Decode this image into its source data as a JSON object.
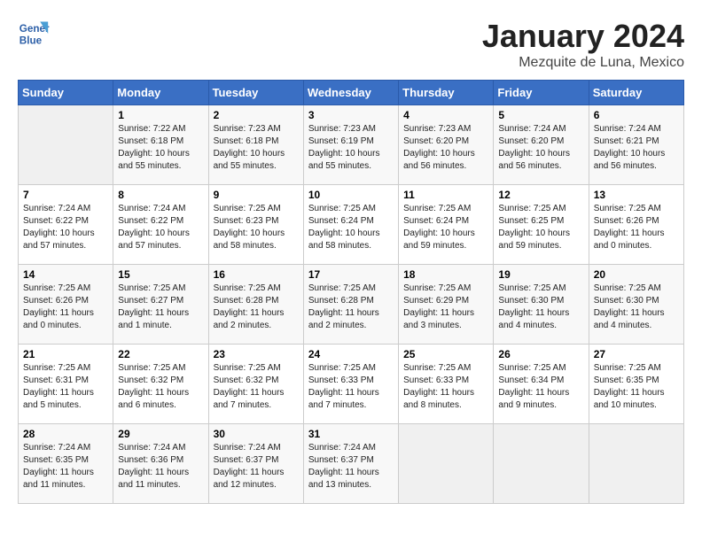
{
  "logo": {
    "line1": "General",
    "line2": "Blue"
  },
  "title": "January 2024",
  "subtitle": "Mezquite de Luna, Mexico",
  "headers": [
    "Sunday",
    "Monday",
    "Tuesday",
    "Wednesday",
    "Thursday",
    "Friday",
    "Saturday"
  ],
  "weeks": [
    [
      {
        "day": "",
        "info": ""
      },
      {
        "day": "1",
        "info": "Sunrise: 7:22 AM\nSunset: 6:18 PM\nDaylight: 10 hours\nand 55 minutes."
      },
      {
        "day": "2",
        "info": "Sunrise: 7:23 AM\nSunset: 6:18 PM\nDaylight: 10 hours\nand 55 minutes."
      },
      {
        "day": "3",
        "info": "Sunrise: 7:23 AM\nSunset: 6:19 PM\nDaylight: 10 hours\nand 55 minutes."
      },
      {
        "day": "4",
        "info": "Sunrise: 7:23 AM\nSunset: 6:20 PM\nDaylight: 10 hours\nand 56 minutes."
      },
      {
        "day": "5",
        "info": "Sunrise: 7:24 AM\nSunset: 6:20 PM\nDaylight: 10 hours\nand 56 minutes."
      },
      {
        "day": "6",
        "info": "Sunrise: 7:24 AM\nSunset: 6:21 PM\nDaylight: 10 hours\nand 56 minutes."
      }
    ],
    [
      {
        "day": "7",
        "info": "Sunrise: 7:24 AM\nSunset: 6:22 PM\nDaylight: 10 hours\nand 57 minutes."
      },
      {
        "day": "8",
        "info": "Sunrise: 7:24 AM\nSunset: 6:22 PM\nDaylight: 10 hours\nand 57 minutes."
      },
      {
        "day": "9",
        "info": "Sunrise: 7:25 AM\nSunset: 6:23 PM\nDaylight: 10 hours\nand 58 minutes."
      },
      {
        "day": "10",
        "info": "Sunrise: 7:25 AM\nSunset: 6:24 PM\nDaylight: 10 hours\nand 58 minutes."
      },
      {
        "day": "11",
        "info": "Sunrise: 7:25 AM\nSunset: 6:24 PM\nDaylight: 10 hours\nand 59 minutes."
      },
      {
        "day": "12",
        "info": "Sunrise: 7:25 AM\nSunset: 6:25 PM\nDaylight: 10 hours\nand 59 minutes."
      },
      {
        "day": "13",
        "info": "Sunrise: 7:25 AM\nSunset: 6:26 PM\nDaylight: 11 hours\nand 0 minutes."
      }
    ],
    [
      {
        "day": "14",
        "info": "Sunrise: 7:25 AM\nSunset: 6:26 PM\nDaylight: 11 hours\nand 0 minutes."
      },
      {
        "day": "15",
        "info": "Sunrise: 7:25 AM\nSunset: 6:27 PM\nDaylight: 11 hours\nand 1 minute."
      },
      {
        "day": "16",
        "info": "Sunrise: 7:25 AM\nSunset: 6:28 PM\nDaylight: 11 hours\nand 2 minutes."
      },
      {
        "day": "17",
        "info": "Sunrise: 7:25 AM\nSunset: 6:28 PM\nDaylight: 11 hours\nand 2 minutes."
      },
      {
        "day": "18",
        "info": "Sunrise: 7:25 AM\nSunset: 6:29 PM\nDaylight: 11 hours\nand 3 minutes."
      },
      {
        "day": "19",
        "info": "Sunrise: 7:25 AM\nSunset: 6:30 PM\nDaylight: 11 hours\nand 4 minutes."
      },
      {
        "day": "20",
        "info": "Sunrise: 7:25 AM\nSunset: 6:30 PM\nDaylight: 11 hours\nand 4 minutes."
      }
    ],
    [
      {
        "day": "21",
        "info": "Sunrise: 7:25 AM\nSunset: 6:31 PM\nDaylight: 11 hours\nand 5 minutes."
      },
      {
        "day": "22",
        "info": "Sunrise: 7:25 AM\nSunset: 6:32 PM\nDaylight: 11 hours\nand 6 minutes."
      },
      {
        "day": "23",
        "info": "Sunrise: 7:25 AM\nSunset: 6:32 PM\nDaylight: 11 hours\nand 7 minutes."
      },
      {
        "day": "24",
        "info": "Sunrise: 7:25 AM\nSunset: 6:33 PM\nDaylight: 11 hours\nand 7 minutes."
      },
      {
        "day": "25",
        "info": "Sunrise: 7:25 AM\nSunset: 6:33 PM\nDaylight: 11 hours\nand 8 minutes."
      },
      {
        "day": "26",
        "info": "Sunrise: 7:25 AM\nSunset: 6:34 PM\nDaylight: 11 hours\nand 9 minutes."
      },
      {
        "day": "27",
        "info": "Sunrise: 7:25 AM\nSunset: 6:35 PM\nDaylight: 11 hours\nand 10 minutes."
      }
    ],
    [
      {
        "day": "28",
        "info": "Sunrise: 7:24 AM\nSunset: 6:35 PM\nDaylight: 11 hours\nand 11 minutes."
      },
      {
        "day": "29",
        "info": "Sunrise: 7:24 AM\nSunset: 6:36 PM\nDaylight: 11 hours\nand 11 minutes."
      },
      {
        "day": "30",
        "info": "Sunrise: 7:24 AM\nSunset: 6:37 PM\nDaylight: 11 hours\nand 12 minutes."
      },
      {
        "day": "31",
        "info": "Sunrise: 7:24 AM\nSunset: 6:37 PM\nDaylight: 11 hours\nand 13 minutes."
      },
      {
        "day": "",
        "info": ""
      },
      {
        "day": "",
        "info": ""
      },
      {
        "day": "",
        "info": ""
      }
    ]
  ]
}
